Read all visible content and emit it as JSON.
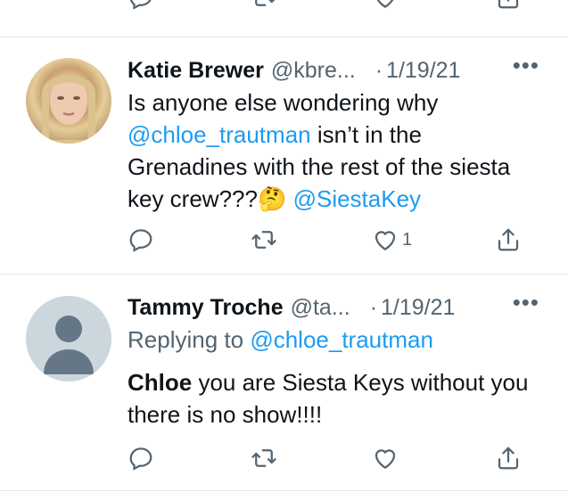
{
  "tweets": [
    {
      "name": "Katie Brewer",
      "handle": "@kbre...",
      "date": "1/19/21",
      "more": "•••",
      "text_parts": [
        {
          "text": "Is anyone else wondering why ",
          "style": "normal"
        },
        {
          "text": "@chloe_trautman",
          "style": "mention"
        },
        {
          "text": " isn’t in the Grenadines with the rest of the siesta key crew???",
          "style": "normal"
        },
        {
          "text": "🤔",
          "style": "emoji"
        },
        {
          "text": " ",
          "style": "normal"
        },
        {
          "text": "@SiestaKey",
          "style": "mention"
        }
      ],
      "actions": {
        "reply": "",
        "retweet": "",
        "like": "1",
        "share": ""
      }
    },
    {
      "name": "Tammy Troche",
      "handle": "@ta...",
      "date": "1/19/21",
      "more": "•••",
      "replying_to_label": "Replying to",
      "replying_to_handle": "@chloe_trautman",
      "text_parts": [
        {
          "text": "Chloe",
          "style": "bold"
        },
        {
          "text": " you are Siesta Keys without you there is no show!!!!",
          "style": "normal"
        }
      ],
      "actions": {
        "reply": "",
        "retweet": "",
        "like": "",
        "share": ""
      }
    }
  ],
  "colors": {
    "accent": "#1d9bf0",
    "muted": "#536471",
    "divider": "#e1e8ed"
  },
  "icons": {
    "reply": "reply-icon",
    "retweet": "retweet-icon",
    "like": "heart-icon",
    "share": "share-icon",
    "more": "more-options-icon"
  }
}
